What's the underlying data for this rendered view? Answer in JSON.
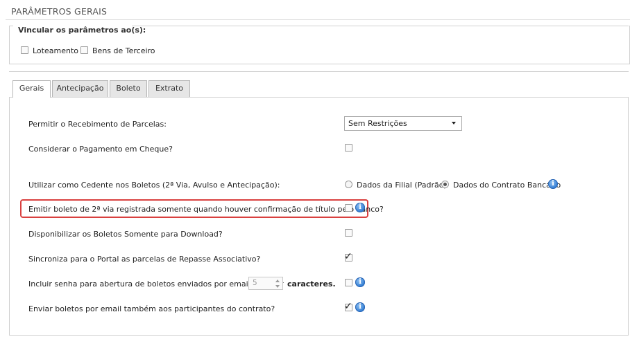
{
  "page": {
    "title": "PARÂMETROS GERAIS"
  },
  "vincular": {
    "legend": "Vincular os parâmetros ao(s):",
    "options": [
      {
        "label": "Loteamento",
        "checked": false
      },
      {
        "label": "Bens de Terceiro",
        "checked": false
      }
    ]
  },
  "tabs": [
    {
      "label": "Gerais",
      "active": true
    },
    {
      "label": "Antecipação",
      "active": false
    },
    {
      "label": "Boleto",
      "active": false
    },
    {
      "label": "Extrato",
      "active": false
    }
  ],
  "settings": {
    "permitir_recebimento": {
      "label": "Permitir o Recebimento de Parcelas:",
      "selected": "Sem Restrições"
    },
    "considerar_cheque": {
      "label": "Considerar o Pagamento em Cheque?",
      "checked": false
    },
    "cedente": {
      "label": "Utilizar como Cedente nos Boletos (2ª Via, Avulso e Antecipação):",
      "options": [
        {
          "label": "Dados da Filial (Padrão)",
          "selected": false
        },
        {
          "label": "Dados do Contrato Bancário",
          "selected": true
        }
      ]
    },
    "emitir_2via": {
      "label": "Emitir boleto de 2ª via registrada somente quando houver confirmação de título pelo banco?",
      "checked": false
    },
    "download": {
      "label": "Disponibilizar os Boletos Somente para Download?",
      "checked": false
    },
    "sincroniza": {
      "label": "Sincroniza para o Portal as parcelas de Repasse Associativo?",
      "checked": true
    },
    "senha": {
      "label": "Incluir senha para abertura de boletos enviados por email? Utilizar",
      "value": "5",
      "suffix": "caracteres.",
      "checked": false
    },
    "enviar_participantes": {
      "label": "Enviar boletos por email também aos participantes do contrato?",
      "checked": true
    }
  },
  "icons": {
    "info": "info-icon",
    "check": "check-icon",
    "dropdown": "chevron-down-icon"
  },
  "colors": {
    "highlight": "#d9403f",
    "info": "#2f7bd3"
  }
}
